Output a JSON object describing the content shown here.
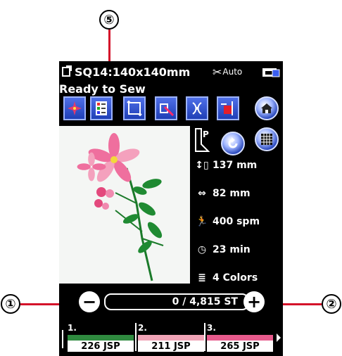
{
  "callouts": {
    "c1": "①",
    "c2": "②",
    "c5": "⑤"
  },
  "status": {
    "title": "SQ14:140x140mm",
    "auto": "Auto"
  },
  "message": "Ready to Sew",
  "toolbar": {
    "icons": [
      "color-shuffle-icon",
      "color-list-icon",
      "trace-frame-icon",
      "basting-icon",
      "hoop-position-icon",
      "start-point-icon",
      "home-icon"
    ]
  },
  "side_buttons": [
    "presser-foot-icon",
    "rotate-icon",
    "grid-icon"
  ],
  "info": {
    "height": "137 mm",
    "width": "82 mm",
    "speed": "400 spm",
    "time": "23 min",
    "colors": "4 Colors"
  },
  "counter": {
    "minus": "−",
    "plus": "+",
    "value": "0 / 4,815 ST"
  },
  "thread_list": [
    {
      "num": "1.",
      "label": "226 JSP",
      "color": "#2f8a3f"
    },
    {
      "num": "2.",
      "label": "211 JSP",
      "color": "#f0a3b6"
    },
    {
      "num": "3.",
      "label": "265 JSP",
      "color": "#e75a8c"
    }
  ]
}
